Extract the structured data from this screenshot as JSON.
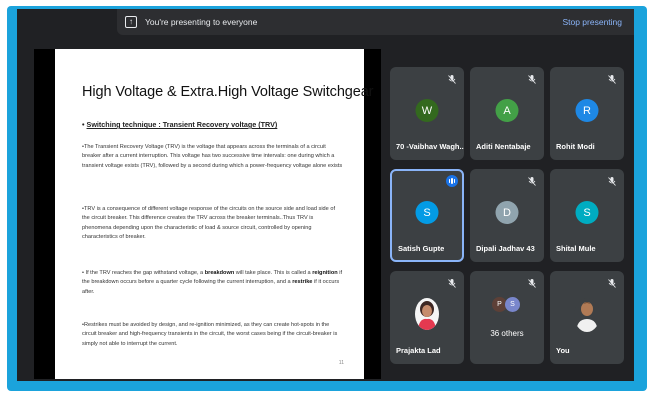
{
  "topbar": {
    "presenting_text": "You're presenting to everyone",
    "stop_label": "Stop presenting"
  },
  "slide": {
    "title": "High Voltage & Extra.High Voltage Switchgear",
    "subtitle_bullet": "•",
    "subtitle": "Switching technique : Transient Recovery voltage (TRV)",
    "para1": "•The Transient Recovery Voltage (TRV) is the voltage that appears across the terminals of a circuit breaker after a current interruption. This voltage has two successive time intervals: one during which a transient voltage exists (TRV), followed by a second during which a power-frequency voltage alone exists",
    "para2": "•TRV is a consequence of different voltage response of the circuits on the source side and load side of the circuit breaker. This difference creates the TRV across the breaker terminals..Thus TRV is phenomena depending upon the characteristic of load & source circuit, controlled by opening characteristics of breaker.",
    "para3_a": "• If the TRV reaches the gap withstand voltage, a ",
    "para3_b": "breakdown",
    "para3_c": " will take place. This is called a ",
    "para3_d": "reignition",
    "para3_e": " if the breakdown occurs before a quarter cycle following the current interruption, and a ",
    "para3_f": "restrike",
    "para3_g": " if it occurs after.",
    "para4": "•Restrikes must be avoided by design, and re-ignition minimized, as they can create hot-spots in the circuit breaker and high-frequency transients in the circuit, the worst cases being if the circuit-breaker is simply not able to interrupt the current.",
    "page_number": "11"
  },
  "participants": [
    {
      "name": "70 -Vaibhav Wagh...",
      "initial": "W",
      "color": "#33691e",
      "muted": true
    },
    {
      "name": "Aditi Nentabaje",
      "initial": "A",
      "color": "#43a047",
      "muted": true
    },
    {
      "name": "Rohit Modi",
      "initial": "R",
      "color": "#1e88e5",
      "muted": true
    },
    {
      "name": "Satish Gupte",
      "initial": "S",
      "color": "#039be5",
      "muted": false,
      "speaking": true
    },
    {
      "name": "Dipali Jadhav 43",
      "initial": "D",
      "color": "#90a4ae",
      "muted": true
    },
    {
      "name": "Shital Mule",
      "initial": "S",
      "color": "#00acc1",
      "muted": true
    },
    {
      "name": "Prajakta Lad",
      "muted": true,
      "photo": true
    },
    {
      "name": "36 others",
      "others": [
        "P",
        "S"
      ],
      "muted": true
    },
    {
      "name": "You",
      "muted": true,
      "photo": true
    }
  ],
  "colors": {
    "frame": "#1ba3dc",
    "background": "#202124",
    "tile": "#3c4043",
    "accent": "#8ab4f8"
  }
}
